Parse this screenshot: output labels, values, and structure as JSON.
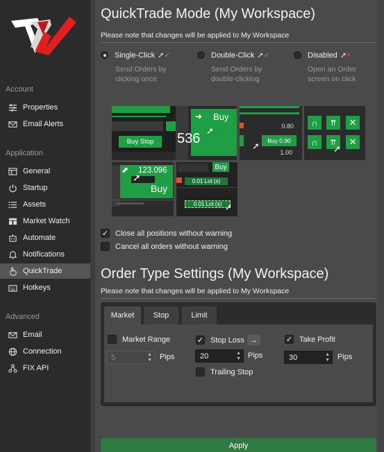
{
  "sidebar": {
    "sections": [
      {
        "title": "Account",
        "items": [
          {
            "label": "Properties",
            "icon": "sliders-icon"
          },
          {
            "label": "Email Alerts",
            "icon": "envelope-icon"
          }
        ]
      },
      {
        "title": "Application",
        "items": [
          {
            "label": "General",
            "icon": "window-icon"
          },
          {
            "label": "Startup",
            "icon": "power-icon"
          },
          {
            "label": "Assets",
            "icon": "list-icon"
          },
          {
            "label": "Market Watch",
            "icon": "market-watch-icon"
          },
          {
            "label": "Automate",
            "icon": "robot-icon"
          },
          {
            "label": "Notifications",
            "icon": "bell-icon"
          },
          {
            "label": "QuickTrade",
            "icon": "hand-pointer-icon",
            "active": true
          },
          {
            "label": "Hotkeys",
            "icon": "keyboard-icon"
          }
        ]
      },
      {
        "title": "Advanced",
        "items": [
          {
            "label": "Email",
            "icon": "email-icon"
          },
          {
            "label": "Connection",
            "icon": "globe-icon"
          },
          {
            "label": "FIX API",
            "icon": "network-icon"
          }
        ]
      }
    ]
  },
  "quicktrade": {
    "title": "QuickTrade Mode (My Workspace)",
    "note": "Please note that changes will be applied to My Workspace",
    "modes": [
      {
        "label": "Single-Click",
        "desc": "Send Orders by clicking once",
        "selected": true,
        "status": "check"
      },
      {
        "label": "Double-Click",
        "desc": "Send Orders by double-clicking",
        "selected": false,
        "status": "check"
      },
      {
        "label": "Disabled",
        "desc": "Open an Order screen on click",
        "selected": false,
        "status": "cross"
      }
    ],
    "thumbs": {
      "buy_stop": "Buy Stop",
      "buy": "Buy",
      "price_536": "536",
      "price_080": "0.80",
      "buy_090": "Buy 0.90",
      "price_100": "1.00",
      "price_123": "123.096",
      "buy2": "Buy",
      "buy3": "Buy",
      "lot1": "0.01 Lot (s)",
      "lot2": "0.01 Lot (s)"
    },
    "checkboxes": [
      {
        "label": "Close all positions without warning",
        "checked": true
      },
      {
        "label": "Cancel all orders without warning",
        "checked": false
      }
    ]
  },
  "ordertype": {
    "title": "Order Type Settings (My Workspace)",
    "note": "Please note that changes will be applied to My Workspace",
    "tabs": [
      "Market",
      "Stop",
      "Limit"
    ],
    "market_range": {
      "label": "Market Range",
      "checked": false,
      "value": "5",
      "unit": "Pips"
    },
    "stop_loss": {
      "label": "Stop Loss",
      "checked": true,
      "value": "20",
      "unit": "Pips"
    },
    "take_profit": {
      "label": "Take Profit",
      "checked": true,
      "value": "30",
      "unit": "Pips"
    },
    "trailing_stop": {
      "label": "Trailing Stop",
      "checked": false
    }
  },
  "apply_label": "Apply",
  "colors": {
    "accent_green": "#1f9e46",
    "check_green": "#3cb95c",
    "cross_red": "#e04848"
  }
}
